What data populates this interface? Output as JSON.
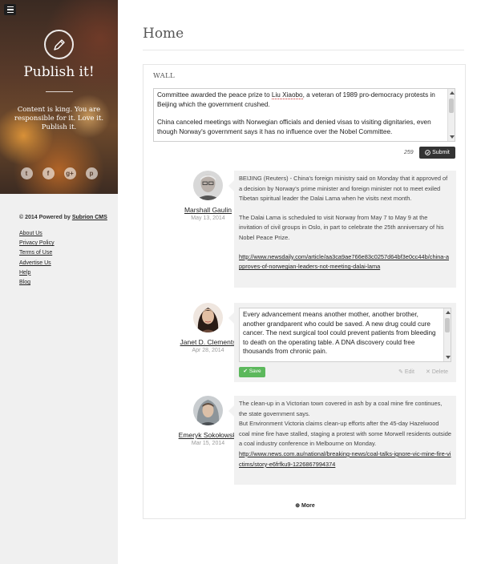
{
  "sidebar": {
    "site_title": "Publish it!",
    "tagline": "Content is king. You are responsible for it. Love it. Publish it.",
    "social": [
      {
        "icon": "twitter-icon",
        "glyph": "t"
      },
      {
        "icon": "facebook-icon",
        "glyph": "f"
      },
      {
        "icon": "google-plus-icon",
        "glyph": "g+"
      },
      {
        "icon": "pinterest-icon",
        "glyph": "p"
      }
    ],
    "powered_prefix": "© 2014 Powered by ",
    "powered_link": "Subrion CMS",
    "links": [
      "About Us",
      "Privacy Policy",
      "Terms of Use",
      "Advertise Us",
      "Help",
      "Blog"
    ]
  },
  "main": {
    "page_title": "Home",
    "wall_label": "WALL",
    "editor": {
      "line1_pre": "Committee awarded the peace prize to ",
      "line1_name": "Liu Xiaobo",
      "line1_post": ", a veteran of 1989 pro-democracy protests in Beijing which the government crushed.",
      "para2": "China canceled meetings with Norwegian officials and denied visas to visiting dignitaries, even though Norway's government says it has no influence over the Nobel Committee."
    },
    "char_count": "259",
    "submit_label": "Submit",
    "posts": [
      {
        "author": "Marshall Gaulin",
        "date": "May 13, 2014",
        "p1": "BEIJING (Reuters) - China's foreign ministry said on Monday that it approved of a decision by Norway's prime minister and foreign minister not to meet exiled Tibetan spiritual leader the Dalai Lama when he visits next month.",
        "p2": "The Dalai Lama is scheduled to visit Norway from May 7 to May 9 at the invitation of civil groups in Oslo, in part to celebrate the 25th anniversary of his Nobel Peace Prize.",
        "link": "http://www.newsdaily.com/article/aa3ca9ae766e83c0257d64bf3e0cc44b/china-approves-of-norwegian-leaders-not-meeting-dalai-lama"
      },
      {
        "author": "Janet D. Clements",
        "date": "Apr 28, 2014",
        "text": "Every advancement means another mother, another brother, another grandparent who could be saved. A new drug could cure cancer. The next surgical tool could prevent patients from bleeding to death on the operating table. A DNA discovery could free thousands from chronic pain.",
        "save_label": "Save",
        "edit_label": "Edit",
        "delete_label": "Delete"
      },
      {
        "author": "Emeryk Sokołowski",
        "date": "Mar 15, 2014",
        "p1": "The clean-up in a Victorian town covered in ash by a coal mine fire continues, the state government says.",
        "p2": "But Environment Victoria claims clean-up efforts after the 45-day Hazelwood coal mine fire have stalled, staging a protest with some Morwell residents outside a coal industry conference in Melbourne on Monday.",
        "link": "http://www.news.com.au/national/breaking-news/coal-talks-ignore-vic-mine-fire-victims/story-e6frfku9-1226867994374"
      }
    ],
    "more_label": "More"
  }
}
